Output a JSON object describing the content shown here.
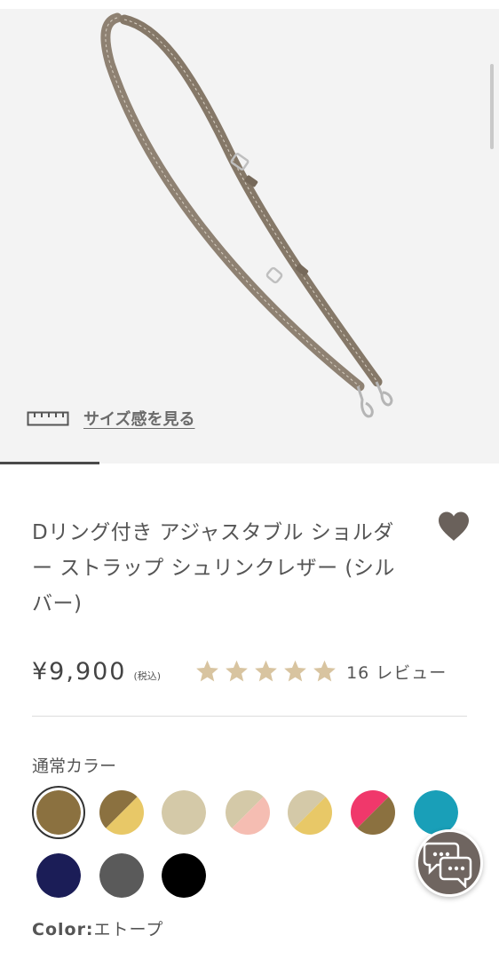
{
  "product": {
    "image_alt": "Dリング付き アジャスタブル ショルダー ストラップ",
    "size_link_label": "サイズ感を見る",
    "title": "Dリング付き アジャスタブル ショルダー ストラップ シュリンクレザー (シルバー)",
    "price": "¥9,900",
    "tax_note": "(税込)",
    "rating": 5,
    "review_count_text": "16 レビュー"
  },
  "colors": {
    "heading": "通常カラー",
    "selected_label_key": "Color:",
    "selected_label_value": "エトープ",
    "swatches": [
      {
        "id": "etoupe",
        "colors": [
          "#8b7140"
        ],
        "selected": true
      },
      {
        "id": "etoupe-yellow",
        "colors": [
          "#8b7140",
          "#e8c867"
        ]
      },
      {
        "id": "beige",
        "colors": [
          "#d4c9a8"
        ]
      },
      {
        "id": "beige-pink",
        "colors": [
          "#d4c9a8",
          "#f5bdb2"
        ]
      },
      {
        "id": "beige-yellow",
        "colors": [
          "#d4c9a8",
          "#e8c867"
        ]
      },
      {
        "id": "pink-etoupe",
        "colors": [
          "#f0386b",
          "#8b7140"
        ]
      },
      {
        "id": "turquoise",
        "colors": [
          "#199fb8"
        ]
      },
      {
        "id": "navy",
        "colors": [
          "#1b1d57"
        ]
      },
      {
        "id": "gray",
        "colors": [
          "#5a5a5a"
        ]
      },
      {
        "id": "black",
        "colors": [
          "#000000"
        ]
      }
    ]
  },
  "theme": {
    "star_color": "#d8c4a0",
    "heart_color": "#6a615b",
    "chat_bg": "#6f6560"
  },
  "icons": {
    "ruler": "ruler-icon",
    "heart": "heart-icon",
    "star": "star-icon",
    "chat": "chat-bubbles-icon"
  }
}
